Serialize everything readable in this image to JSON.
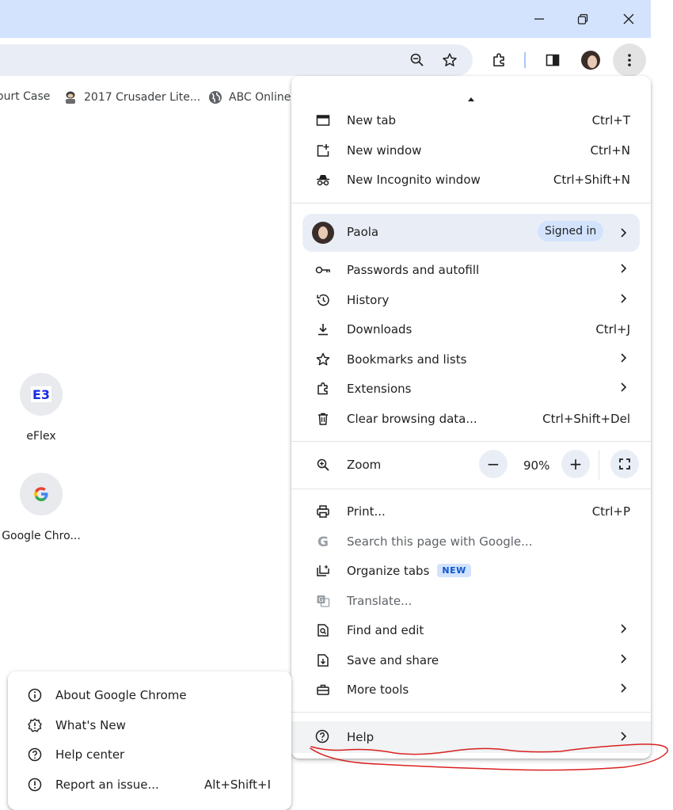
{
  "window": {
    "minimize_icon": "minimize-icon",
    "restore_icon": "restore-icon",
    "close_icon": "close-icon"
  },
  "toolbar": {
    "icons": [
      "zoom-icon",
      "star-icon",
      "extensions-icon",
      "side-panel-icon",
      "profile-avatar",
      "more-menu-icon"
    ]
  },
  "bookmarks": {
    "items": [
      {
        "label": "ourt Case"
      },
      {
        "label": "2017 Crusader Lite...",
        "icon": "bookmark-favicon-icon"
      },
      {
        "label": "ABC Online",
        "icon": "globe-icon"
      }
    ]
  },
  "shortcuts": [
    {
      "label": "eFlex",
      "icon": "eflex-icon"
    },
    {
      "label": "Google Chro...",
      "icon": "google-g-icon"
    }
  ],
  "menu": {
    "new_tab": {
      "label": "New tab",
      "shortcut": "Ctrl+T"
    },
    "new_window": {
      "label": "New window",
      "shortcut": "Ctrl+N"
    },
    "incognito": {
      "label": "New Incognito window",
      "shortcut": "Ctrl+Shift+N"
    },
    "profile": {
      "name": "Paola",
      "status": "Signed in"
    },
    "passwords": {
      "label": "Passwords and autofill"
    },
    "history": {
      "label": "History"
    },
    "downloads": {
      "label": "Downloads",
      "shortcut": "Ctrl+J"
    },
    "bookmarks": {
      "label": "Bookmarks and lists"
    },
    "extensions": {
      "label": "Extensions"
    },
    "clear": {
      "label": "Clear browsing data...",
      "shortcut": "Ctrl+Shift+Del"
    },
    "zoom": {
      "label": "Zoom",
      "value": "90%",
      "minus": "−",
      "plus": "+"
    },
    "print": {
      "label": "Print...",
      "shortcut": "Ctrl+P"
    },
    "search_google": {
      "label": "Search this page with Google..."
    },
    "organize_tabs": {
      "label": "Organize tabs",
      "badge": "NEW"
    },
    "translate": {
      "label": "Translate..."
    },
    "find_edit": {
      "label": "Find and edit"
    },
    "save_share": {
      "label": "Save and share"
    },
    "more_tools": {
      "label": "More tools"
    },
    "help": {
      "label": "Help"
    }
  },
  "help_submenu": {
    "about": {
      "label": "About Google Chrome"
    },
    "whats_new": {
      "label": "What's New"
    },
    "help_center": {
      "label": "Help center"
    },
    "report": {
      "label": "Report an issue...",
      "shortcut": "Alt+Shift+I"
    }
  },
  "colors": {
    "titlebar": "#d3e3fd",
    "omnibox": "#e9eef6",
    "accent_blue": "#0b57d0",
    "annotation_red": "#d92020"
  }
}
